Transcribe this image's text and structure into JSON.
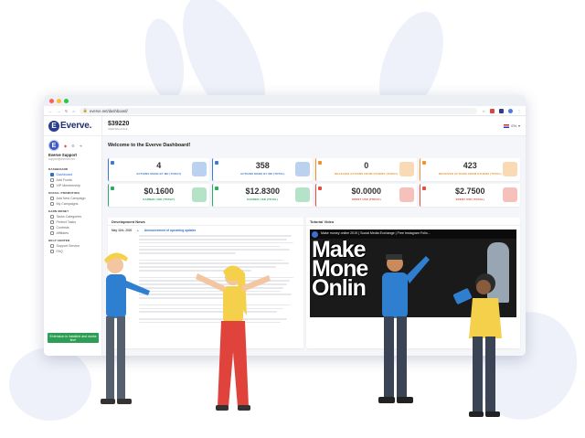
{
  "browser": {
    "url": "everve.net/dashboard/"
  },
  "sidebar": {
    "logo_text": "Everve.",
    "logo_mark": "E",
    "avatar_letter": "E",
    "user_name": "Everve Support",
    "user_sub": "support@everve.net",
    "sections": [
      {
        "title": "DASHBOARD",
        "items": [
          {
            "label": "Dashboard",
            "active": true,
            "icon": "home-icon"
          },
          {
            "label": "Add Funds",
            "active": false,
            "icon": "wallet-icon"
          },
          {
            "label": "VIP Membership",
            "active": false,
            "icon": "star-icon"
          }
        ]
      },
      {
        "title": "SOCIAL PROMOTION",
        "items": [
          {
            "label": "Add New Campaign",
            "active": false,
            "icon": "plus-icon"
          },
          {
            "label": "My Campaigns",
            "active": false,
            "icon": "list-icon"
          }
        ]
      },
      {
        "title": "EARN MONEY",
        "items": [
          {
            "label": "Tasks Categories",
            "active": false,
            "icon": "grid-icon"
          },
          {
            "label": "Perfect Tasks",
            "active": false,
            "icon": "check-icon"
          },
          {
            "label": "Contests",
            "active": false,
            "icon": "trophy-icon"
          },
          {
            "label": "Affiliates",
            "active": false,
            "icon": "users-icon"
          }
        ]
      },
      {
        "title": "HELP CENTER",
        "items": [
          {
            "label": "Support Service",
            "active": false,
            "icon": "help-icon"
          },
          {
            "label": "FAQ",
            "active": false,
            "icon": "question-icon"
          }
        ]
      }
    ],
    "extension_button": "Extension is installed and works fine!"
  },
  "topbar": {
    "balance": "$39220",
    "balance_sub": "WEB BALANCE",
    "language": "EN"
  },
  "welcome": "Welcome to the Everve Dashboard!",
  "stat_cards": [
    {
      "value": "4",
      "label": "ACTIONS MADE BY ME (TODAY)",
      "color": "#3a7bd5"
    },
    {
      "value": "358",
      "label": "ACTIONS MADE BY ME (TOTAL)",
      "color": "#3a7bd5"
    },
    {
      "value": "0",
      "label": "RECEIVED ACTIONS FROM OTHERS (TODAY)",
      "color": "#f0932b"
    },
    {
      "value": "423",
      "label": "RECEIVED ACTIONS FROM OTHERS (TOTAL)",
      "color": "#f0932b"
    },
    {
      "value": "$0.1600",
      "label": "EARNED USD (TODAY)",
      "color": "#27ae60"
    },
    {
      "value": "$12.8300",
      "label": "EARNED USD (TOTAL)",
      "color": "#27ae60"
    },
    {
      "value": "$0.0000",
      "label": "SPENT USD (TODAY)",
      "color": "#e74c3c"
    },
    {
      "value": "$2.7500",
      "label": "SPENT USD (TOTAL)",
      "color": "#e74c3c"
    }
  ],
  "news": {
    "header": "Development News",
    "date": "May 11th, 2020",
    "title": "Announcement of upcoming updates"
  },
  "video": {
    "header": "Tutorial Video",
    "title": "Make money online 2019 | Social Media Exchange | Free Instagram Follo...",
    "overlay_lines": [
      "Make",
      "Mone",
      "Onlin"
    ]
  }
}
